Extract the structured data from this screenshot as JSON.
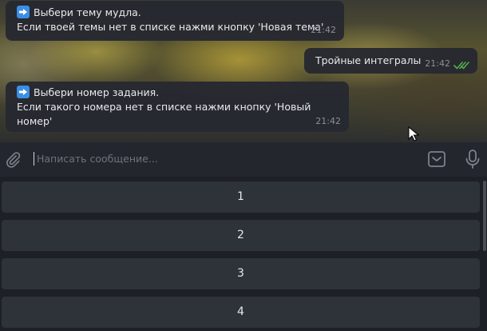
{
  "messages": [
    {
      "line1": "Выбери тему мудла.",
      "line2": "Если твоей темы нет в списке нажми кнопку 'Новая тема'",
      "time": "21:42"
    },
    {
      "text": "Тройные интегралы",
      "time": "21:42"
    },
    {
      "line1": "Выбери номер задания.",
      "line2": "Если такого номера нет в списке нажми кнопку 'Новый номер'",
      "time": "21:42"
    }
  ],
  "composer": {
    "placeholder": "Написать сообщение...",
    "value": ""
  },
  "keyboard": {
    "buttons": [
      "1",
      "2",
      "3",
      "4"
    ]
  },
  "icons": {
    "arrow": "right-arrow-emoji",
    "attach": "paperclip-icon",
    "keyboard_toggle": "keyboard-toggle-icon",
    "mic": "microphone-icon",
    "read": "double-check-icon"
  },
  "colors": {
    "bubble": "#262930",
    "composer": "#23262d",
    "keyboard_bg": "#1d2026",
    "button": "#2e3239",
    "read_ticks": "#4fae4e"
  }
}
